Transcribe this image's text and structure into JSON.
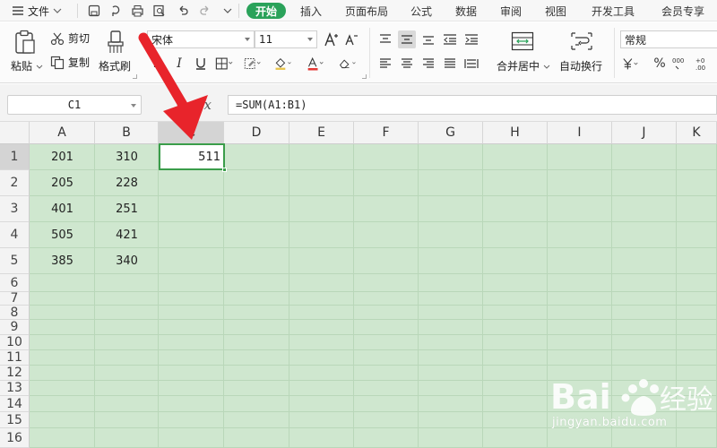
{
  "menubar": {
    "file": "文件",
    "tabs": [
      {
        "label": "开始",
        "active": true
      },
      {
        "label": "插入",
        "active": false
      },
      {
        "label": "页面布局",
        "active": false
      },
      {
        "label": "公式",
        "active": false
      },
      {
        "label": "数据",
        "active": false
      },
      {
        "label": "审阅",
        "active": false
      },
      {
        "label": "视图",
        "active": false
      },
      {
        "label": "开发工具",
        "active": false
      },
      {
        "label": "会员专享",
        "active": false
      }
    ]
  },
  "ribbon": {
    "paste": "粘贴",
    "cut": "剪切",
    "copy": "复制",
    "format_painter": "格式刷",
    "font_name": "宋体",
    "font_size": "11",
    "merge_center": "合并居中",
    "wrap_text": "自动换行",
    "number_format": "常规",
    "percent": "%"
  },
  "formula_bar": {
    "name_box": "C1",
    "fx": "fx",
    "formula": "=SUM(A1:B1)"
  },
  "grid": {
    "columns": [
      "A",
      "B",
      "C",
      "D",
      "E",
      "F",
      "G",
      "H",
      "I",
      "J",
      "K"
    ],
    "rows": [
      "1",
      "2",
      "3",
      "4",
      "5",
      "6",
      "7",
      "8",
      "9",
      "10",
      "11",
      "12",
      "13",
      "14",
      "15",
      "16"
    ],
    "cells": {
      "A1": "201",
      "B1": "310",
      "C1": "511",
      "A2": "205",
      "B2": "228",
      "A3": "401",
      "B3": "251",
      "A4": "505",
      "B4": "421",
      "A5": "385",
      "B5": "340"
    },
    "selected_cell": "C1"
  },
  "colors": {
    "accent": "#2aa25a",
    "grid_bg": "#cfe7cf",
    "selection": "#3a9d4a",
    "arrow": "#e8242b"
  },
  "watermark": {
    "brand": "Bai",
    "brand2": "经验",
    "url": "jingyan.baidu.com"
  }
}
